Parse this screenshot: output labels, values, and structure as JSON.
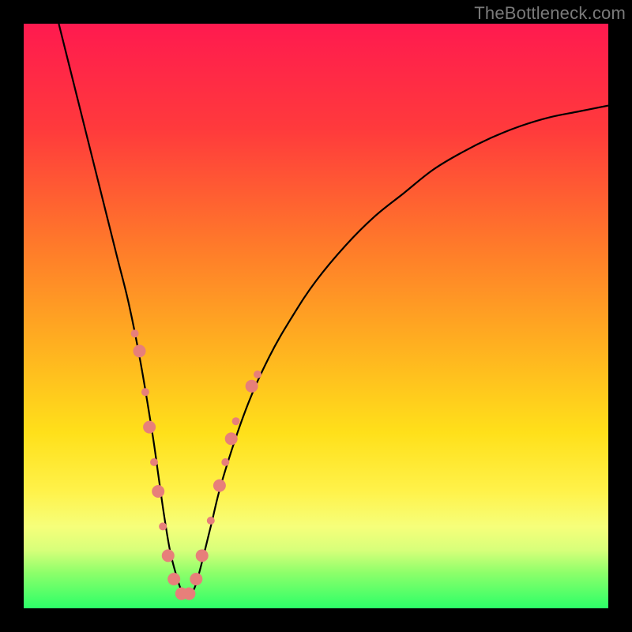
{
  "watermark": "TheBottleneck.com",
  "chart_data": {
    "type": "line",
    "title": "",
    "xlabel": "",
    "ylabel": "",
    "xlim": [
      0,
      100
    ],
    "ylim": [
      0,
      100
    ],
    "gradient_stops": [
      {
        "offset": 0,
        "color": "#ff1a4f"
      },
      {
        "offset": 18,
        "color": "#ff3a3c"
      },
      {
        "offset": 38,
        "color": "#ff7a2a"
      },
      {
        "offset": 55,
        "color": "#ffb020"
      },
      {
        "offset": 70,
        "color": "#ffe01a"
      },
      {
        "offset": 80,
        "color": "#fff24a"
      },
      {
        "offset": 86,
        "color": "#f6ff7a"
      },
      {
        "offset": 90,
        "color": "#d8ff7a"
      },
      {
        "offset": 94,
        "color": "#8cff6a"
      },
      {
        "offset": 100,
        "color": "#2cff68"
      }
    ],
    "series": [
      {
        "name": "bottleneck-curve",
        "x": [
          6,
          8,
          10,
          12,
          14,
          16,
          18,
          20,
          22,
          23,
          24,
          25,
          26,
          27,
          28,
          29,
          30,
          32,
          34,
          38,
          42,
          46,
          50,
          55,
          60,
          65,
          70,
          75,
          80,
          85,
          90,
          95,
          100
        ],
        "y": [
          100,
          92,
          84,
          76,
          68,
          60,
          52,
          42,
          30,
          23,
          16,
          10,
          6,
          3,
          2,
          3,
          6,
          14,
          22,
          34,
          43,
          50,
          56,
          62,
          67,
          71,
          75,
          78,
          80.5,
          82.5,
          84,
          85,
          86
        ]
      }
    ],
    "markers": {
      "name": "highlight-dots",
      "color": "#e77f7a",
      "radius_small": 5,
      "radius_large": 8,
      "points": [
        {
          "x": 19.0,
          "y": 47,
          "r": "small"
        },
        {
          "x": 19.8,
          "y": 44,
          "r": "large"
        },
        {
          "x": 20.8,
          "y": 37,
          "r": "small"
        },
        {
          "x": 21.5,
          "y": 31,
          "r": "large"
        },
        {
          "x": 22.3,
          "y": 25,
          "r": "small"
        },
        {
          "x": 23.0,
          "y": 20,
          "r": "large"
        },
        {
          "x": 23.8,
          "y": 14,
          "r": "small"
        },
        {
          "x": 24.7,
          "y": 9,
          "r": "large"
        },
        {
          "x": 25.7,
          "y": 5,
          "r": "large"
        },
        {
          "x": 27.0,
          "y": 2.5,
          "r": "large"
        },
        {
          "x": 28.3,
          "y": 2.5,
          "r": "large"
        },
        {
          "x": 29.5,
          "y": 5,
          "r": "large"
        },
        {
          "x": 30.5,
          "y": 9,
          "r": "large"
        },
        {
          "x": 32.0,
          "y": 15,
          "r": "small"
        },
        {
          "x": 33.5,
          "y": 21,
          "r": "large"
        },
        {
          "x": 34.5,
          "y": 25,
          "r": "small"
        },
        {
          "x": 35.5,
          "y": 29,
          "r": "large"
        },
        {
          "x": 36.3,
          "y": 32,
          "r": "small"
        },
        {
          "x": 39.0,
          "y": 38,
          "r": "large"
        },
        {
          "x": 40.0,
          "y": 40,
          "r": "small"
        }
      ]
    }
  }
}
